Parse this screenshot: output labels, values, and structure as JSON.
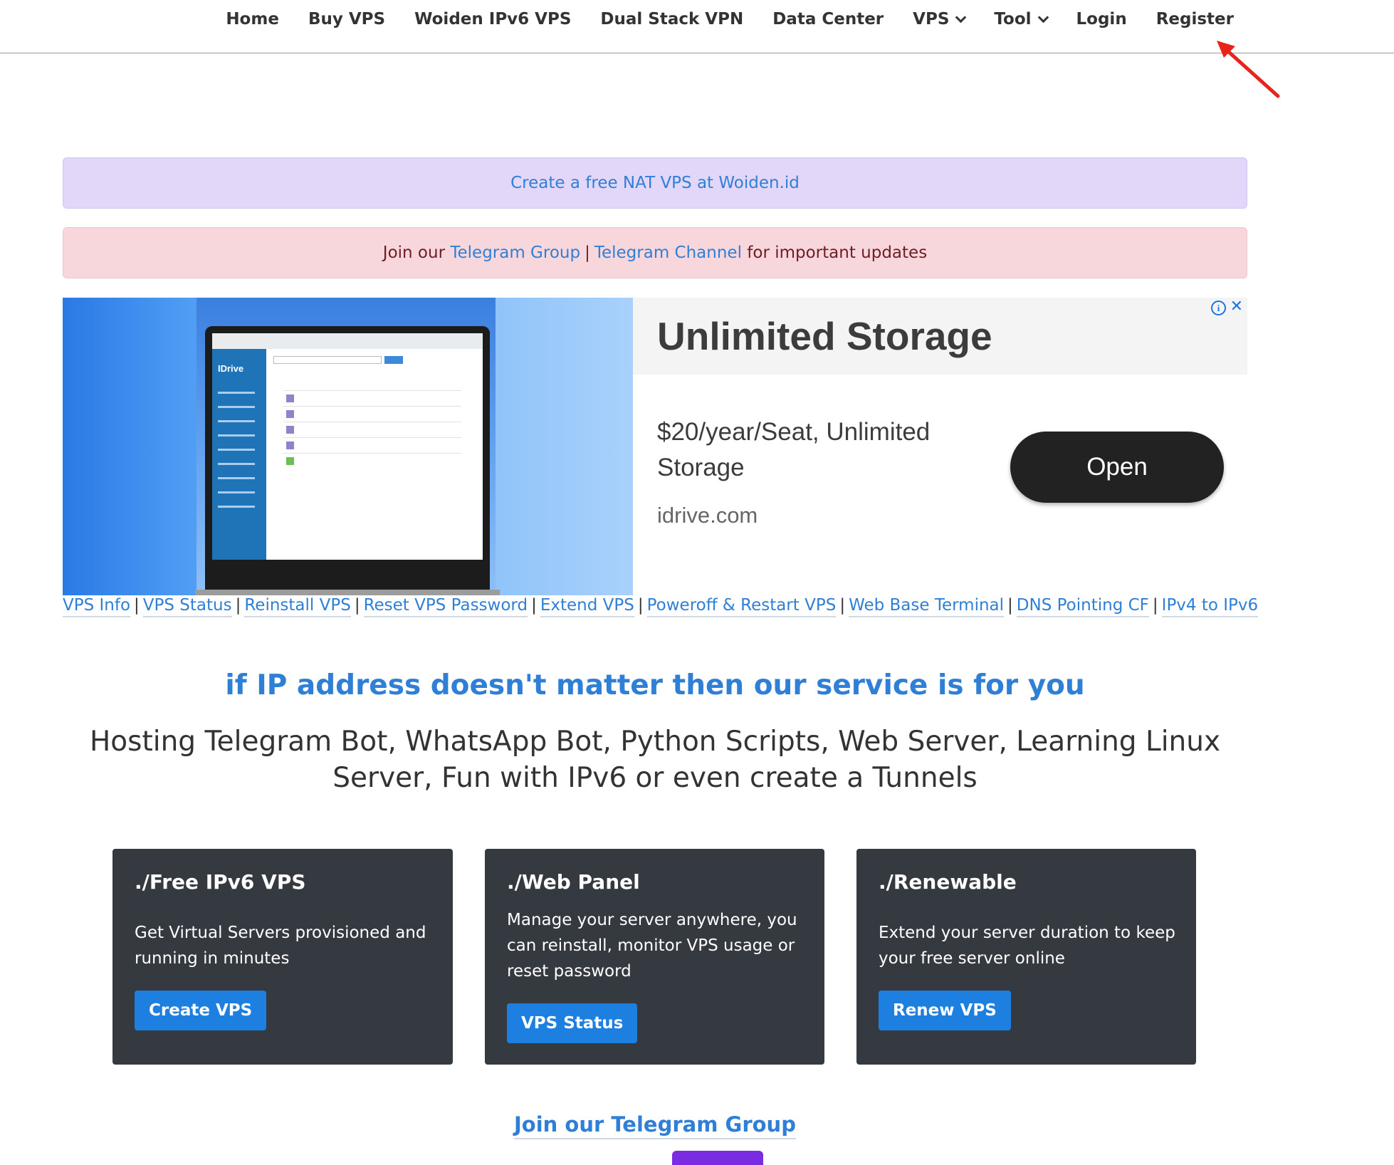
{
  "nav": {
    "items": [
      {
        "label": "Home"
      },
      {
        "label": "Buy VPS"
      },
      {
        "label": "Woiden IPv6 VPS"
      },
      {
        "label": "Dual Stack VPN"
      },
      {
        "label": "Data Center"
      },
      {
        "label": "VPS",
        "dropdown": true
      },
      {
        "label": "Tool",
        "dropdown": true
      },
      {
        "label": "Login"
      },
      {
        "label": "Register"
      }
    ]
  },
  "annotation": {
    "arrow_color": "#e8231c",
    "target": "Register"
  },
  "alerts": {
    "promo": "Create a free NAT VPS at Woiden.id",
    "telegram": {
      "prefix": "Join our",
      "group_link": "Telegram Group",
      "separator": "|",
      "channel_link": "Telegram Channel",
      "suffix": "for important updates"
    }
  },
  "ad": {
    "title": "Unlimited Storage",
    "description": "$20/year/Seat, Unlimited Storage",
    "domain": "idrive.com",
    "cta": "Open",
    "info_icon": "info-icon",
    "close_icon": "close-icon"
  },
  "quick_links": [
    "VPS Info",
    "VPS Status",
    "Reinstall VPS",
    "Reset VPS Password",
    "Extend VPS",
    "Poweroff & Restart VPS",
    "Web Base Terminal",
    "DNS Pointing CF",
    "IPv4 to IPv6"
  ],
  "hero": {
    "tagline": "if IP address doesn't matter then our service is for you",
    "subtitle": "Hosting Telegram Bot, WhatsApp Bot, Python Scripts, Web Server, Learning Linux Server, Fun with IPv6 or even create a Tunnels"
  },
  "cards": [
    {
      "title": "./Free IPv6 VPS",
      "text": "Get Virtual Servers provisioned and running in minutes",
      "button": "Create VPS"
    },
    {
      "title": "./Web Panel",
      "text": "Manage your server anywhere, you can reinstall, monitor VPS usage or reset password",
      "button": "VPS Status"
    },
    {
      "title": "./Renewable",
      "text": "Extend your server duration to keep your free server online",
      "button": "Renew VPS"
    }
  ],
  "footer": {
    "join_link": "Join our Telegram Group"
  },
  "colors": {
    "link": "#2f7fd6",
    "card_bg": "#343a40",
    "button": "#1d7fe0",
    "promo_bg": "#e3d7f9",
    "alert_bg": "#f8d7dc"
  }
}
